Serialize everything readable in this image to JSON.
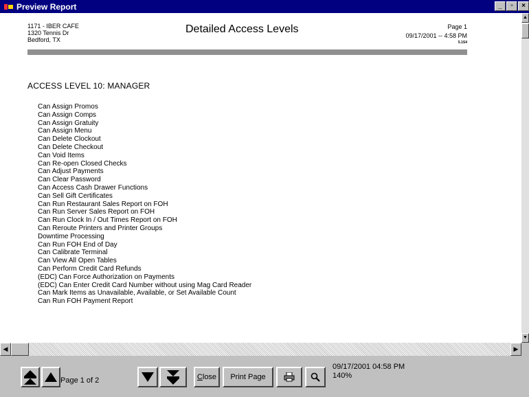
{
  "window": {
    "title": "Preview Report",
    "buttons": {
      "minimize": "_",
      "maximize": "▫",
      "close": "×"
    }
  },
  "report": {
    "address": [
      "1171 - IBER CAFE",
      "1320 Tennis Dr",
      "Bedford, TX"
    ],
    "title": "Detailed Access Levels",
    "page": "Page 1",
    "date_time": "09/17/2001 --  4:58 PM",
    "version": "5.1S4",
    "access_level_heading": "ACCESS LEVEL 10: MANAGER",
    "permissions": [
      "Can Assign Promos",
      "Can Assign Comps",
      "Can Assign Gratuity",
      "Can Assign Menu",
      "Can Delete Clockout",
      "Can Delete Checkout",
      "Can Void Items",
      "Can Re-open Closed Checks",
      "Can Adjust Payments",
      "Can Clear Password",
      "Can Access Cash Drawer Functions",
      "Can Sell Gift Certificates",
      "Can Run Restaurant Sales Report on FOH",
      "Can Run Server Sales Report on FOH",
      "Can Run Clock In / Out Times Report on FOH",
      "Can Reroute Printers and Printer Groups",
      "Downtime Processing",
      "Can Run FOH End of Day",
      "Can Calibrate Terminal",
      "Can View All Open Tables",
      "Can Perform Credit Card Refunds",
      "(EDC) Can Force Authorization on Payments",
      "(EDC) Can Enter Credit Card Number without using Mag Card Reader",
      "Can Mark Items as Unavailable, Available, or Set Available Count",
      "Can Run FOH Payment Report"
    ]
  },
  "toolbar": {
    "page_label": "Page 1 of 2",
    "close_label_first": "C",
    "close_label_rest": "lose",
    "print_page_label": "Print Page",
    "status_datetime": "09/17/2001 04:58 PM",
    "zoom": "140%"
  },
  "icons": {
    "first_page": "first-page-icon",
    "prev_page": "prev-page-icon",
    "next_page": "next-page-icon",
    "last_page": "last-page-icon",
    "printer": "printer-icon",
    "zoom": "magnifier-icon"
  }
}
